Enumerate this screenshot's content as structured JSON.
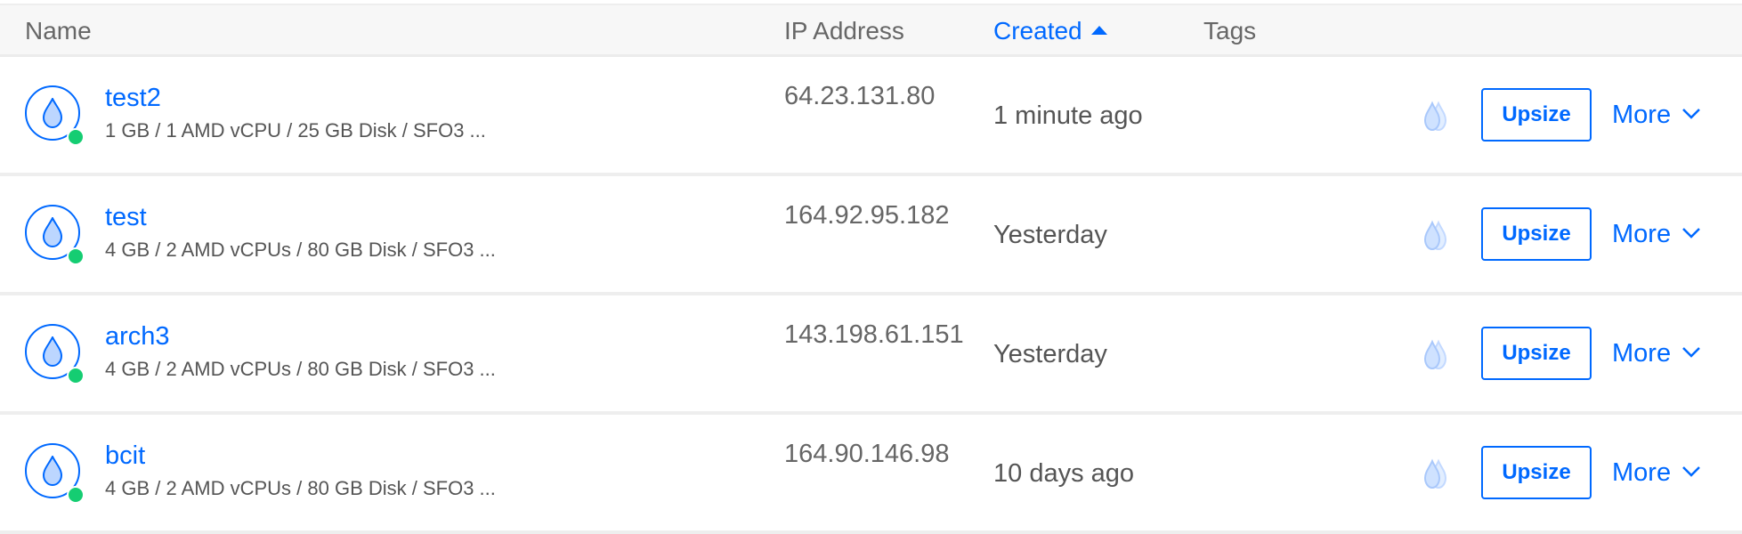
{
  "table": {
    "columns": {
      "name": "Name",
      "ip_address": "IP Address",
      "created": "Created",
      "tags": "Tags"
    },
    "sort": {
      "column": "Created",
      "direction": "ascending",
      "indicator_icon": "caret-up-icon"
    },
    "rows": [
      {
        "name": "test2",
        "spec": "1 GB / 1 AMD vCPU / 25 GB Disk / SFO3 ...",
        "ip": "64.23.131.80",
        "created": "1 minute ago",
        "status_color": "#15cd72",
        "upsize_label": "Upsize",
        "more_label": "More"
      },
      {
        "name": "test",
        "spec": "4 GB / 2 AMD vCPUs / 80 GB Disk / SFO3 ...",
        "ip": "164.92.95.182",
        "created": "Yesterday",
        "status_color": "#15cd72",
        "upsize_label": "Upsize",
        "more_label": "More"
      },
      {
        "name": "arch3",
        "spec": "4 GB / 2 AMD vCPUs / 80 GB Disk / SFO3 ...",
        "ip": "143.198.61.151",
        "created": "Yesterday",
        "status_color": "#15cd72",
        "upsize_label": "Upsize",
        "more_label": "More"
      },
      {
        "name": "bcit",
        "spec": "4 GB / 2 AMD vCPUs / 80 GB Disk / SFO3 ...",
        "ip": "164.90.146.98",
        "created": "10 days ago",
        "status_color": "#15cd72",
        "upsize_label": "Upsize",
        "more_label": "More"
      }
    ],
    "icons": {
      "droplet": "droplet-icon",
      "backups": "backup-droplets-icon",
      "more": "chevron-down-icon",
      "status": "status-online-icon"
    },
    "colors": {
      "accent": "#0069ff",
      "online": "#15cd72",
      "header_bg": "#f7f7f7",
      "divider": "#eeeeee"
    }
  }
}
